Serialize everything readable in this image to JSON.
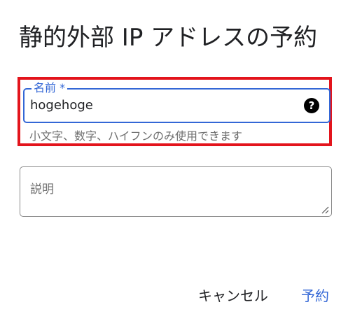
{
  "dialog": {
    "title": "静的外部 IP アドレスの予約"
  },
  "name_field": {
    "label": "名前 *",
    "value": "hogehoge",
    "hint": "小文字、数字、ハイフンのみ使用できます",
    "help_icon": "help-circle-icon"
  },
  "description_field": {
    "placeholder": "説明"
  },
  "actions": {
    "cancel_label": "キャンセル",
    "reserve_label": "予約"
  },
  "colors": {
    "accent": "#3367d6",
    "highlight": "#e3141c"
  }
}
